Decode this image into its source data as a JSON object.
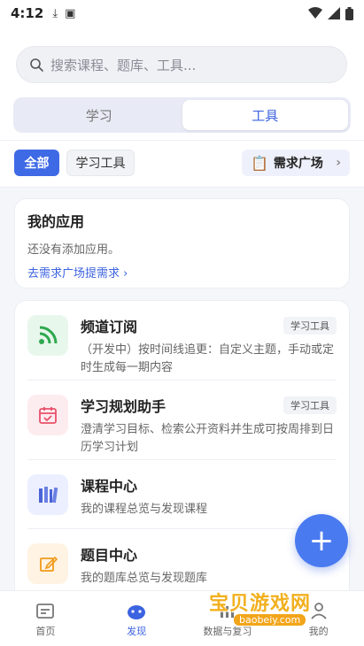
{
  "status_bar": {
    "time": "4:12"
  },
  "search": {
    "placeholder": "搜索课程、题库、工具..."
  },
  "segment": {
    "tabs": [
      "学习",
      "工具"
    ],
    "active": 1
  },
  "filters": {
    "all": "全部",
    "tool": "学习工具",
    "square": "需求广场"
  },
  "my_apps": {
    "title": "我的应用",
    "empty": "还没有添加应用。",
    "link": "去需求广场提需求"
  },
  "tools": [
    {
      "name": "频道订阅",
      "desc": "（开发中）按时间线追更：自定义主题，手动或定时生成每一期内容",
      "tag": "学习工具"
    },
    {
      "name": "学习规划助手",
      "desc": "澄清学习目标、检索公开资料并生成可按周排到日历学习计划",
      "tag": "学习工具"
    },
    {
      "name": "课程中心",
      "desc": "我的课程总览与发现课程",
      "tag": ""
    },
    {
      "name": "题目中心",
      "desc": "我的题库总览与发现题库",
      "tag": ""
    }
  ],
  "bottom_nav": [
    "首页",
    "发现",
    "数据与复习",
    "我的"
  ],
  "watermark": {
    "text": "宝贝游戏网",
    "url": "baobeiy.com"
  },
  "colors": {
    "accent": "#3c63e0",
    "fab": "#4a7af0"
  }
}
